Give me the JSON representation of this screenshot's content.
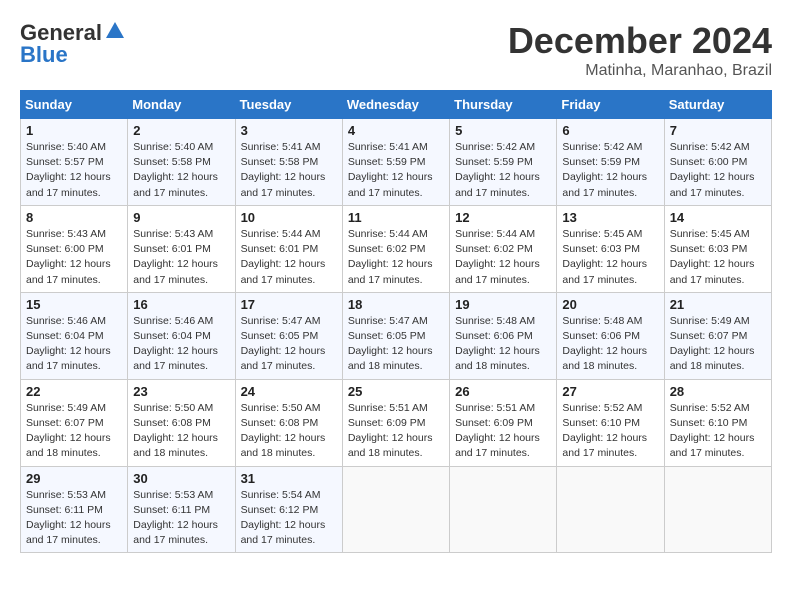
{
  "logo": {
    "line1": "General",
    "line2": "Blue"
  },
  "title": {
    "month": "December 2024",
    "location": "Matinha, Maranhao, Brazil"
  },
  "calendar": {
    "headers": [
      "Sunday",
      "Monday",
      "Tuesday",
      "Wednesday",
      "Thursday",
      "Friday",
      "Saturday"
    ],
    "weeks": [
      [
        {
          "day": "1",
          "sunrise": "5:40 AM",
          "sunset": "5:57 PM",
          "daylight": "12 hours and 17 minutes."
        },
        {
          "day": "2",
          "sunrise": "5:40 AM",
          "sunset": "5:58 PM",
          "daylight": "12 hours and 17 minutes."
        },
        {
          "day": "3",
          "sunrise": "5:41 AM",
          "sunset": "5:58 PM",
          "daylight": "12 hours and 17 minutes."
        },
        {
          "day": "4",
          "sunrise": "5:41 AM",
          "sunset": "5:59 PM",
          "daylight": "12 hours and 17 minutes."
        },
        {
          "day": "5",
          "sunrise": "5:42 AM",
          "sunset": "5:59 PM",
          "daylight": "12 hours and 17 minutes."
        },
        {
          "day": "6",
          "sunrise": "5:42 AM",
          "sunset": "5:59 PM",
          "daylight": "12 hours and 17 minutes."
        },
        {
          "day": "7",
          "sunrise": "5:42 AM",
          "sunset": "6:00 PM",
          "daylight": "12 hours and 17 minutes."
        }
      ],
      [
        {
          "day": "8",
          "sunrise": "5:43 AM",
          "sunset": "6:00 PM",
          "daylight": "12 hours and 17 minutes."
        },
        {
          "day": "9",
          "sunrise": "5:43 AM",
          "sunset": "6:01 PM",
          "daylight": "12 hours and 17 minutes."
        },
        {
          "day": "10",
          "sunrise": "5:44 AM",
          "sunset": "6:01 PM",
          "daylight": "12 hours and 17 minutes."
        },
        {
          "day": "11",
          "sunrise": "5:44 AM",
          "sunset": "6:02 PM",
          "daylight": "12 hours and 17 minutes."
        },
        {
          "day": "12",
          "sunrise": "5:44 AM",
          "sunset": "6:02 PM",
          "daylight": "12 hours and 17 minutes."
        },
        {
          "day": "13",
          "sunrise": "5:45 AM",
          "sunset": "6:03 PM",
          "daylight": "12 hours and 17 minutes."
        },
        {
          "day": "14",
          "sunrise": "5:45 AM",
          "sunset": "6:03 PM",
          "daylight": "12 hours and 17 minutes."
        }
      ],
      [
        {
          "day": "15",
          "sunrise": "5:46 AM",
          "sunset": "6:04 PM",
          "daylight": "12 hours and 17 minutes."
        },
        {
          "day": "16",
          "sunrise": "5:46 AM",
          "sunset": "6:04 PM",
          "daylight": "12 hours and 17 minutes."
        },
        {
          "day": "17",
          "sunrise": "5:47 AM",
          "sunset": "6:05 PM",
          "daylight": "12 hours and 17 minutes."
        },
        {
          "day": "18",
          "sunrise": "5:47 AM",
          "sunset": "6:05 PM",
          "daylight": "12 hours and 18 minutes."
        },
        {
          "day": "19",
          "sunrise": "5:48 AM",
          "sunset": "6:06 PM",
          "daylight": "12 hours and 18 minutes."
        },
        {
          "day": "20",
          "sunrise": "5:48 AM",
          "sunset": "6:06 PM",
          "daylight": "12 hours and 18 minutes."
        },
        {
          "day": "21",
          "sunrise": "5:49 AM",
          "sunset": "6:07 PM",
          "daylight": "12 hours and 18 minutes."
        }
      ],
      [
        {
          "day": "22",
          "sunrise": "5:49 AM",
          "sunset": "6:07 PM",
          "daylight": "12 hours and 18 minutes."
        },
        {
          "day": "23",
          "sunrise": "5:50 AM",
          "sunset": "6:08 PM",
          "daylight": "12 hours and 18 minutes."
        },
        {
          "day": "24",
          "sunrise": "5:50 AM",
          "sunset": "6:08 PM",
          "daylight": "12 hours and 18 minutes."
        },
        {
          "day": "25",
          "sunrise": "5:51 AM",
          "sunset": "6:09 PM",
          "daylight": "12 hours and 18 minutes."
        },
        {
          "day": "26",
          "sunrise": "5:51 AM",
          "sunset": "6:09 PM",
          "daylight": "12 hours and 17 minutes."
        },
        {
          "day": "27",
          "sunrise": "5:52 AM",
          "sunset": "6:10 PM",
          "daylight": "12 hours and 17 minutes."
        },
        {
          "day": "28",
          "sunrise": "5:52 AM",
          "sunset": "6:10 PM",
          "daylight": "12 hours and 17 minutes."
        }
      ],
      [
        {
          "day": "29",
          "sunrise": "5:53 AM",
          "sunset": "6:11 PM",
          "daylight": "12 hours and 17 minutes."
        },
        {
          "day": "30",
          "sunrise": "5:53 AM",
          "sunset": "6:11 PM",
          "daylight": "12 hours and 17 minutes."
        },
        {
          "day": "31",
          "sunrise": "5:54 AM",
          "sunset": "6:12 PM",
          "daylight": "12 hours and 17 minutes."
        },
        null,
        null,
        null,
        null
      ]
    ],
    "labels": {
      "sunrise": "Sunrise:",
      "sunset": "Sunset:",
      "daylight": "Daylight:"
    }
  }
}
